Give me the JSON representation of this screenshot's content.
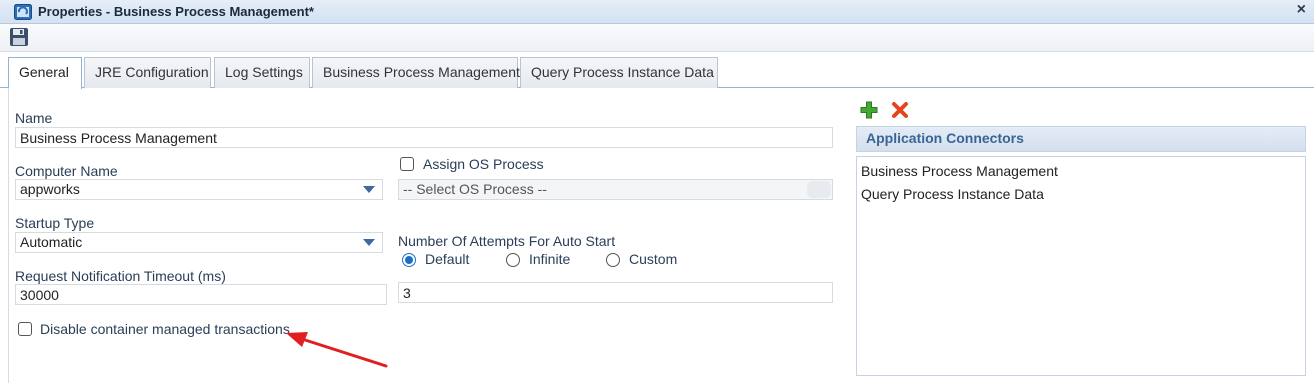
{
  "window": {
    "title": "Properties - Business Process Management*"
  },
  "tabs": [
    {
      "label": "General"
    },
    {
      "label": "JRE Configuration"
    },
    {
      "label": "Log Settings"
    },
    {
      "label": "Business Process Management"
    },
    {
      "label": "Query Process Instance Data"
    }
  ],
  "form": {
    "name_label": "Name",
    "name_value": "Business Process Management",
    "computer_label": "Computer Name",
    "computer_value": "appworks",
    "assign_os_label": "Assign OS Process",
    "os_process_placeholder": "-- Select OS Process --",
    "startup_label": "Startup Type",
    "startup_value": "Automatic",
    "attempts_label": "Number Of Attempts For Auto Start",
    "radio_default": "Default",
    "radio_infinite": "Infinite",
    "radio_custom": "Custom",
    "attempts_value": "3",
    "timeout_label": "Request Notification Timeout (ms)",
    "timeout_value": "30000",
    "disable_cmt_label": "Disable container managed transactions"
  },
  "connectors": {
    "header": "Application Connectors",
    "items": [
      "Business Process Management",
      "Query Process Instance Data"
    ]
  },
  "icons": {
    "app": "app-window-icon",
    "close": "close-icon",
    "save": "save-icon",
    "add": "add-icon",
    "delete": "delete-icon",
    "dropdown": "chevron-down-icon"
  },
  "colors": {
    "accent": "#1c6fc6",
    "header_text": "#3a6496",
    "annotation_arrow": "#e02020"
  }
}
